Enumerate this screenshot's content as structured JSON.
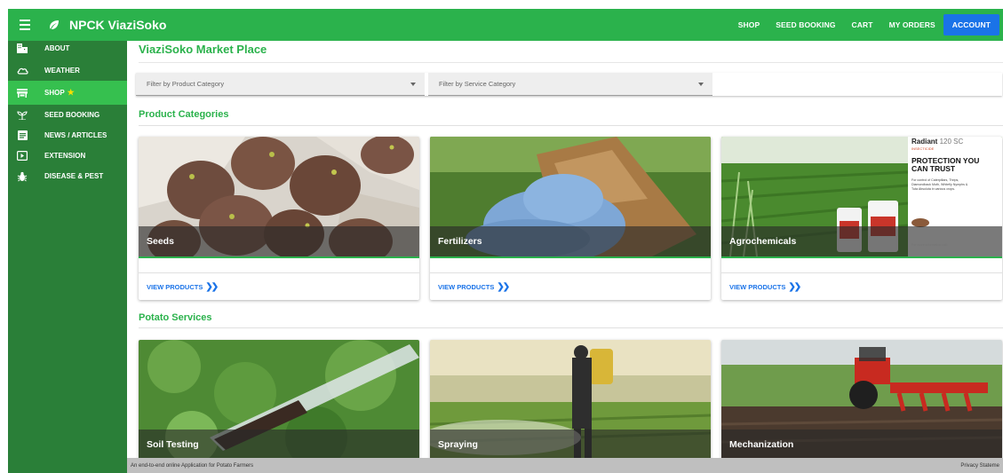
{
  "app": {
    "title": "NPCK ViaziSoko"
  },
  "topnav": [
    {
      "label": "SHOP"
    },
    {
      "label": "SEED BOOKING"
    },
    {
      "label": "CART"
    },
    {
      "label": "MY ORDERS"
    },
    {
      "label": "ACCOUNT"
    }
  ],
  "sidebar": {
    "items": [
      {
        "label": "ABOUT",
        "icon": "building-icon"
      },
      {
        "label": "WEATHER",
        "icon": "cloud-icon"
      },
      {
        "label": "SHOP",
        "icon": "store-icon",
        "active": true,
        "star": "★"
      },
      {
        "label": "SEED BOOKING",
        "icon": "sprout-icon"
      },
      {
        "label": "NEWS / ARTICLES",
        "icon": "article-icon"
      },
      {
        "label": "EXTENSION",
        "icon": "video-icon"
      },
      {
        "label": "DISEASE & PEST",
        "icon": "bug-icon"
      }
    ]
  },
  "main": {
    "title": "ViaziSoko Market Place",
    "filters": {
      "product": {
        "placeholder": "Filter by Product Category"
      },
      "service": {
        "placeholder": "Filter by Service Category"
      }
    },
    "product_section": {
      "title": "Product Categories",
      "cards": [
        {
          "name": "Seeds",
          "action": "VIEW PRODUCTS"
        },
        {
          "name": "Fertilizers",
          "action": "VIEW PRODUCTS"
        },
        {
          "name": "Agrochemicals",
          "action": "VIEW PRODUCTS"
        }
      ],
      "ad": {
        "brand": "Radiant",
        "variant": "120 SC",
        "type": "INSECTICIDE",
        "headline_1": "PROTECTION YOU",
        "headline_2": "CAN TRUST",
        "body_1": "For control of Caterpillars, Thrips,",
        "body_2": "Diamondback Moth, Whitefly Nymphs &",
        "body_3": "Tuta Absoluta in various crops.",
        "contact_1": "For more information call:",
        "contact_2": "(+254) 724 221 870"
      }
    },
    "service_section": {
      "title": "Potato Services",
      "cards": [
        {
          "name": "Soil Testing"
        },
        {
          "name": "Spraying"
        },
        {
          "name": "Mechanization"
        }
      ]
    }
  },
  "footer": {
    "left": "An end-to-end online Application for Potato Farmers",
    "right": "Privacy Stateme"
  },
  "colors": {
    "brand": "#2bb24c",
    "sidebar": "#2a7f38",
    "accent": "#1a73e8"
  }
}
